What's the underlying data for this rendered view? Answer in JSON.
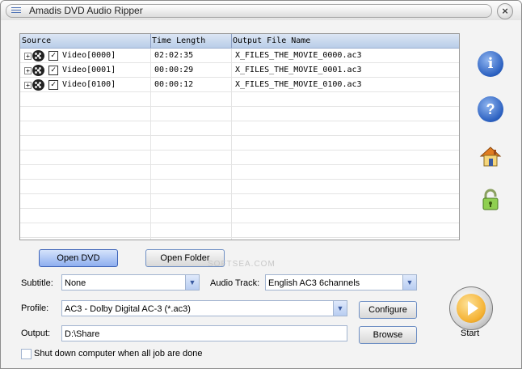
{
  "window": {
    "title": "Amadis DVD Audio Ripper"
  },
  "grid": {
    "columns": [
      "Source",
      "Time Length",
      "Output File Name"
    ],
    "rows": [
      {
        "source": "Video[0000]",
        "time": "02:02:35",
        "output": "X_FILES_THE_MOVIE_0000.ac3",
        "checked": true
      },
      {
        "source": "Video[0001]",
        "time": "00:00:29",
        "output": "X_FILES_THE_MOVIE_0001.ac3",
        "checked": true
      },
      {
        "source": "Video[0100]",
        "time": "00:00:12",
        "output": "X_FILES_THE_MOVIE_0100.ac3",
        "checked": true
      }
    ]
  },
  "buttons": {
    "open_dvd": "Open  DVD",
    "open_folder": "Open  Folder",
    "configure": "Configure",
    "browse": "Browse",
    "start": "Start"
  },
  "form": {
    "subtitle_label": "Subtitle:",
    "subtitle_value": "None",
    "audio_track_label": "Audio Track:",
    "audio_track_value": "English AC3 6channels",
    "profile_label": "Profile:",
    "profile_value": "AC3 - Dolby Digital AC-3 (*.ac3)",
    "output_label": "Output:",
    "output_value": "D:\\Share",
    "shutdown_label": "Shut down computer when all job are done"
  },
  "side_icons": [
    "info-icon",
    "help-icon",
    "home-icon",
    "lock-icon"
  ],
  "watermark": "SOFTSEA.COM",
  "colors": {
    "accent": "#2a5fbf",
    "header": "#b9cde8",
    "start": "#f5b335"
  }
}
